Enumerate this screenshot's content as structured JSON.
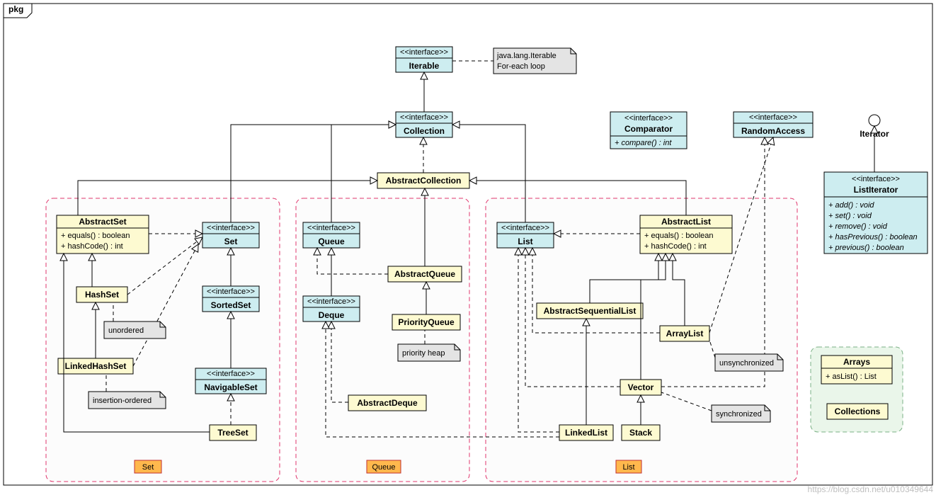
{
  "package_label": "pkg",
  "watermark": "https://blog.csdn.net/u010349644",
  "interfaces": {
    "iterable": {
      "stereo": "<<interface>>",
      "name": "Iterable"
    },
    "collection": {
      "stereo": "<<interface>>",
      "name": "Collection"
    },
    "set": {
      "stereo": "<<interface>>",
      "name": "Set"
    },
    "sortedset": {
      "stereo": "<<interface>>",
      "name": "SortedSet"
    },
    "navigableset": {
      "stereo": "<<interface>>",
      "name": "NavigableSet"
    },
    "queue": {
      "stereo": "<<interface>>",
      "name": "Queue"
    },
    "deque": {
      "stereo": "<<interface>>",
      "name": "Deque"
    },
    "list": {
      "stereo": "<<interface>>",
      "name": "List"
    },
    "comparator": {
      "stereo": "<<interface>>",
      "name": "Comparator",
      "m1": "+ compare() : int"
    },
    "randomaccess": {
      "stereo": "<<interface>>",
      "name": "RandomAccess"
    },
    "listiterator": {
      "stereo": "<<interface>>",
      "name": "ListIterator",
      "m1": "+ add() : void",
      "m2": "+ set() : void",
      "m3": "+ remove() : void",
      "m4": "+ hasPrevious() : boolean",
      "m5": "+ previous() : boolean"
    }
  },
  "classes": {
    "abstractcollection": {
      "name": "AbstractCollection"
    },
    "abstractset": {
      "name": "AbstractSet",
      "m1": "+ equals() : boolean",
      "m2": "+ hashCode() : int"
    },
    "hashset": {
      "name": "HashSet"
    },
    "linkedhashset": {
      "name": "LinkedHashSet"
    },
    "treeset": {
      "name": "TreeSet"
    },
    "abstractqueue": {
      "name": "AbstractQueue"
    },
    "priorityqueue": {
      "name": "PriorityQueue"
    },
    "abstractdeque": {
      "name": "AbstractDeque"
    },
    "abstractlist": {
      "name": "AbstractList",
      "m1": "+ equals() : boolean",
      "m2": "+ hashCode() : int"
    },
    "abstractsequentiallist": {
      "name": "AbstractSequentialList"
    },
    "arraylist": {
      "name": "ArrayList"
    },
    "vector": {
      "name": "Vector"
    },
    "stack": {
      "name": "Stack"
    },
    "linkedlist": {
      "name": "LinkedList"
    },
    "arrays": {
      "name": "Arrays",
      "m1": "+ asList() : List"
    },
    "collections": {
      "name": "Collections"
    }
  },
  "notes": {
    "iterable": {
      "l1": "java.lang.Iterable",
      "l2": "For-each loop"
    },
    "unordered": "unordered",
    "insertionordered": "insertion-ordered",
    "priorityheap": "priority heap",
    "unsynchronized": "unsynchronized",
    "synchronized": "synchronized"
  },
  "iterator_label": "Iterator",
  "groups": {
    "set": "Set",
    "queue": "Queue",
    "list": "List"
  }
}
